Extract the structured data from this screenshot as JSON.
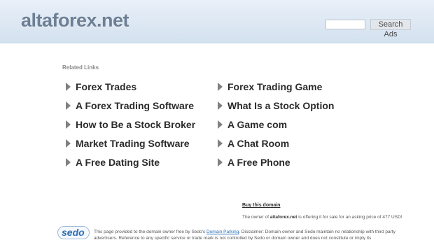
{
  "header": {
    "site_title": "altaforex.net",
    "search_placeholder": "",
    "search_button_label": "Search Ads"
  },
  "related": {
    "title": "Related Links",
    "left_links": [
      "Forex Trades",
      "A Forex Trading Software",
      "How to Be a Stock Broker",
      "Market Trading Software",
      "A Free Dating Site"
    ],
    "right_links": [
      "Forex Trading Game",
      "What Is a Stock Option",
      "A Game com",
      "A Chat Room",
      "A Free Phone"
    ]
  },
  "sale": {
    "buy_link": "Buy this domain",
    "prefix": "The owner of ",
    "domain": "altaforex.net",
    "suffix": " is offering it for sale for an asking price of 477 USD!"
  },
  "footer": {
    "logo_text": "sedo",
    "disclaimer_prefix": "This page provided to the domain owner free by Sedo's ",
    "disclaimer_link": "Domain Parking",
    "disclaimer_suffix": ". Disclaimer: Domain owner and Sedo maintain no relationship with third party advertisers. Reference to any specific service or trade mark is not controlled by Sedo or domain owner and does not constitute or imply its"
  }
}
